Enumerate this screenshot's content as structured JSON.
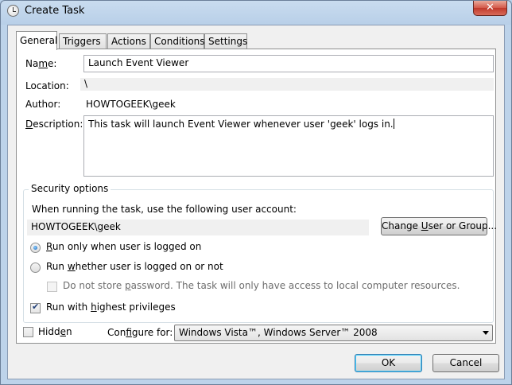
{
  "window": {
    "title": "Create Task",
    "close_label": "✕"
  },
  "tabs": [
    {
      "label": "General"
    },
    {
      "label": "Triggers"
    },
    {
      "label": "Actions"
    },
    {
      "label": "Conditions"
    },
    {
      "label": "Settings"
    }
  ],
  "general": {
    "name_label_prefix": "Na",
    "name_label_u": "m",
    "name_label_suffix": "e:",
    "name_value": "Launch Event Viewer",
    "location_label": "Location:",
    "location_value": "\\",
    "author_label": "Author:",
    "author_value": "HOWTOGEEK\\geek",
    "description_label_u": "D",
    "description_label_suffix": "escription:",
    "description_value": "This task will launch Event Viewer whenever user 'geek' logs in."
  },
  "security": {
    "group_title": "Security options",
    "account_prompt": "When running the task, use the following user account:",
    "account_value": "HOWTOGEEK\\geek",
    "change_button_prefix": "Change ",
    "change_button_u": "U",
    "change_button_suffix": "ser or Group...",
    "radio_logged_on_u": "R",
    "radio_logged_on_suffix": "un only when user is logged on",
    "radio_whether_prefix": "Run ",
    "radio_whether_u": "w",
    "radio_whether_suffix": "hether user is logged on or not",
    "no_store_prefix": "Do not store ",
    "no_store_u": "p",
    "no_store_suffix": "assword.  The task will only have access to local computer resources.",
    "highest_prefix": "Run with ",
    "highest_u": "h",
    "highest_suffix": "ighest privileges",
    "radio_logged_on_checked": true,
    "highest_checked": true
  },
  "footer": {
    "hidden_prefix": "Hidd",
    "hidden_u": "e",
    "hidden_suffix": "n",
    "configure_prefix": "Con",
    "configure_u": "f",
    "configure_suffix": "igure for:",
    "configure_value": "Windows Vista™, Windows Server™ 2008",
    "ok_label": "OK",
    "cancel_label": "Cancel"
  }
}
